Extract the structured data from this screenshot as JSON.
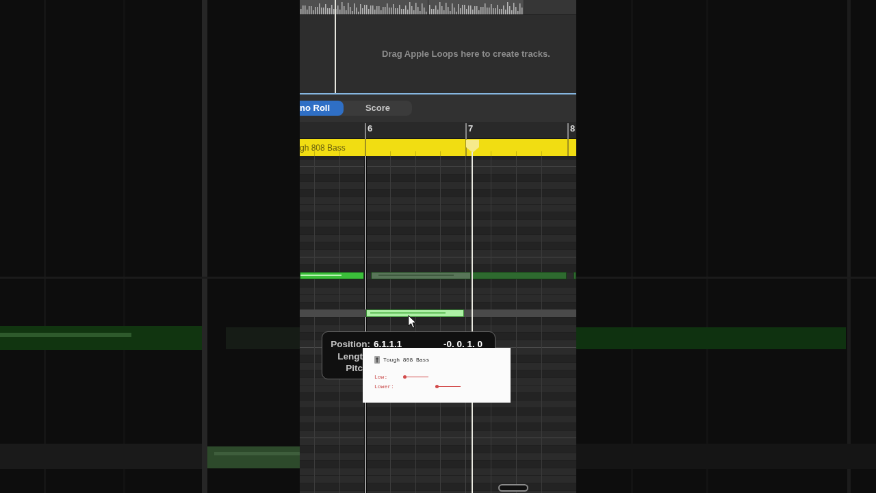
{
  "arrange": {
    "hint": "Drag Apple Loops here to create tracks."
  },
  "editor": {
    "tabs": [
      {
        "label": "no Roll",
        "selected": true
      },
      {
        "label": "Score",
        "selected": false
      }
    ]
  },
  "ruler": {
    "bars": [
      "6",
      "7",
      "8"
    ]
  },
  "region": {
    "name": "gh 808 Bass"
  },
  "notes": [
    {
      "color": "#3bbf3a",
      "selected": false
    },
    {
      "color": "#587558",
      "selected": false
    },
    {
      "color": "#2e6a2f",
      "selected": false
    },
    {
      "color": "#2e6a2f",
      "selected": false
    },
    {
      "color": "#aef0a6",
      "selected": true
    }
  ],
  "tooltip": {
    "rows": [
      {
        "label": "Position:",
        "value": "6.1.1.1",
        "delta": "-0. 0. 1. 0"
      },
      {
        "label": "Lengt"
      },
      {
        "label": "Pitc"
      }
    ]
  },
  "popup": {
    "title": "Tough 808 Bass",
    "sliders": [
      {
        "label": "Low:",
        "level": 0
      },
      {
        "label": "Lower:",
        "level": 0
      }
    ]
  }
}
